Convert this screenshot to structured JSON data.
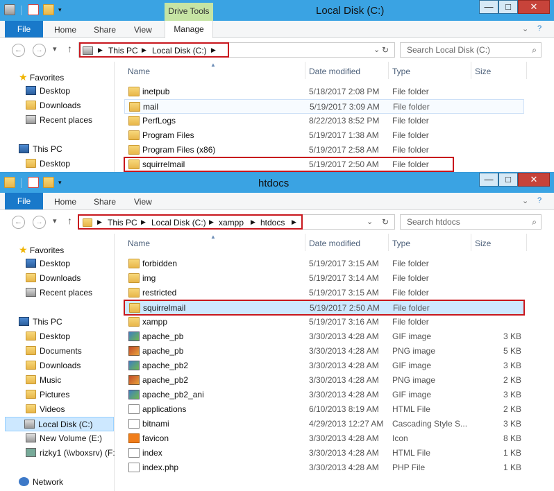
{
  "window1": {
    "title": "Local Disk (C:)",
    "ribbon": {
      "file": "File",
      "tabs": [
        "Home",
        "Share",
        "View"
      ],
      "drive_tools": "Drive Tools",
      "manage": "Manage"
    },
    "address": [
      "This PC",
      "Local Disk (C:)"
    ],
    "search_placeholder": "Search Local Disk (C:)",
    "nav": [
      {
        "label": "Favorites",
        "icon": "star-icon"
      },
      {
        "label": "Desktop",
        "icon": "desktop-icon"
      },
      {
        "label": "Downloads",
        "icon": "downloads-icon"
      },
      {
        "label": "Recent places",
        "icon": "recent-places-icon"
      },
      {
        "label": "This PC",
        "icon": "computer-icon"
      },
      {
        "label": "Desktop",
        "icon": "desktop-icon"
      }
    ],
    "columns": [
      "Name",
      "Date modified",
      "Type",
      "Size"
    ],
    "rows": [
      {
        "name": "inetpub",
        "date": "5/18/2017 2:08 PM",
        "type": "File folder",
        "size": "",
        "icon": "folder-icon"
      },
      {
        "name": "mail",
        "date": "5/19/2017 3:09 AM",
        "type": "File folder",
        "size": "",
        "icon": "folder-icon"
      },
      {
        "name": "PerfLogs",
        "date": "8/22/2013 8:52 PM",
        "type": "File folder",
        "size": "",
        "icon": "folder-icon"
      },
      {
        "name": "Program Files",
        "date": "5/19/2017 1:38 AM",
        "type": "File folder",
        "size": "",
        "icon": "folder-icon"
      },
      {
        "name": "Program Files (x86)",
        "date": "5/19/2017 2:58 AM",
        "type": "File folder",
        "size": "",
        "icon": "folder-icon"
      },
      {
        "name": "squirrelmail",
        "date": "5/19/2017 2:50 AM",
        "type": "File folder",
        "size": "",
        "icon": "folder-icon"
      }
    ]
  },
  "window2": {
    "title": "htdocs",
    "ribbon": {
      "file": "File",
      "tabs": [
        "Home",
        "Share",
        "View"
      ]
    },
    "address": [
      "This PC",
      "Local Disk (C:)",
      "xampp",
      "htdocs"
    ],
    "search_placeholder": "Search htdocs",
    "nav": [
      {
        "label": "Favorites",
        "icon": "star-icon"
      },
      {
        "label": "Desktop",
        "icon": "desktop-icon"
      },
      {
        "label": "Downloads",
        "icon": "downloads-icon"
      },
      {
        "label": "Recent places",
        "icon": "recent-places-icon"
      },
      {
        "label": "This PC",
        "icon": "computer-icon"
      },
      {
        "label": "Desktop",
        "icon": "desktop-icon"
      },
      {
        "label": "Documents",
        "icon": "documents-icon"
      },
      {
        "label": "Downloads",
        "icon": "downloads-icon"
      },
      {
        "label": "Music",
        "icon": "music-icon"
      },
      {
        "label": "Pictures",
        "icon": "pictures-icon"
      },
      {
        "label": "Videos",
        "icon": "videos-icon"
      },
      {
        "label": "Local Disk (C:)",
        "icon": "local-disk-icon"
      },
      {
        "label": "New Volume (E:)",
        "icon": "drive-icon"
      },
      {
        "label": "rizky1 (\\\\vboxsrv) (F:",
        "icon": "network-drive-icon"
      },
      {
        "label": "Network",
        "icon": "network-icon"
      }
    ],
    "columns": [
      "Name",
      "Date modified",
      "Type",
      "Size"
    ],
    "rows": [
      {
        "name": "forbidden",
        "date": "5/19/2017 3:15 AM",
        "type": "File folder",
        "size": "",
        "icon": "folder-icon"
      },
      {
        "name": "img",
        "date": "5/19/2017 3:14 AM",
        "type": "File folder",
        "size": "",
        "icon": "folder-icon"
      },
      {
        "name": "restricted",
        "date": "5/19/2017 3:15 AM",
        "type": "File folder",
        "size": "",
        "icon": "folder-icon"
      },
      {
        "name": "squirrelmail",
        "date": "5/19/2017 2:50 AM",
        "type": "File folder",
        "size": "",
        "icon": "folder-icon"
      },
      {
        "name": "xampp",
        "date": "5/19/2017 3:16 AM",
        "type": "File folder",
        "size": "",
        "icon": "folder-icon"
      },
      {
        "name": "apache_pb",
        "date": "3/30/2013 4:28 AM",
        "type": "GIF image",
        "size": "3 KB",
        "icon": "gif-image-icon"
      },
      {
        "name": "apache_pb",
        "date": "3/30/2013 4:28 AM",
        "type": "PNG image",
        "size": "5 KB",
        "icon": "png-image-icon"
      },
      {
        "name": "apache_pb2",
        "date": "3/30/2013 4:28 AM",
        "type": "GIF image",
        "size": "3 KB",
        "icon": "gif-image-icon"
      },
      {
        "name": "apache_pb2",
        "date": "3/30/2013 4:28 AM",
        "type": "PNG image",
        "size": "2 KB",
        "icon": "png-image-icon"
      },
      {
        "name": "apache_pb2_ani",
        "date": "3/30/2013 4:28 AM",
        "type": "GIF image",
        "size": "3 KB",
        "icon": "gif-image-icon"
      },
      {
        "name": "applications",
        "date": "6/10/2013 8:19 AM",
        "type": "HTML File",
        "size": "2 KB",
        "icon": "html-file-icon"
      },
      {
        "name": "bitnami",
        "date": "4/29/2013 12:27 AM",
        "type": "Cascading Style S...",
        "size": "3 KB",
        "icon": "css-file-icon"
      },
      {
        "name": "favicon",
        "date": "3/30/2013 4:28 AM",
        "type": "Icon",
        "size": "8 KB",
        "icon": "favicon-icon"
      },
      {
        "name": "index",
        "date": "3/30/2013 4:28 AM",
        "type": "HTML File",
        "size": "1 KB",
        "icon": "html-file-icon"
      },
      {
        "name": "index.php",
        "date": "3/30/2013 4:28 AM",
        "type": "PHP File",
        "size": "1 KB",
        "icon": "php-file-icon"
      }
    ]
  }
}
